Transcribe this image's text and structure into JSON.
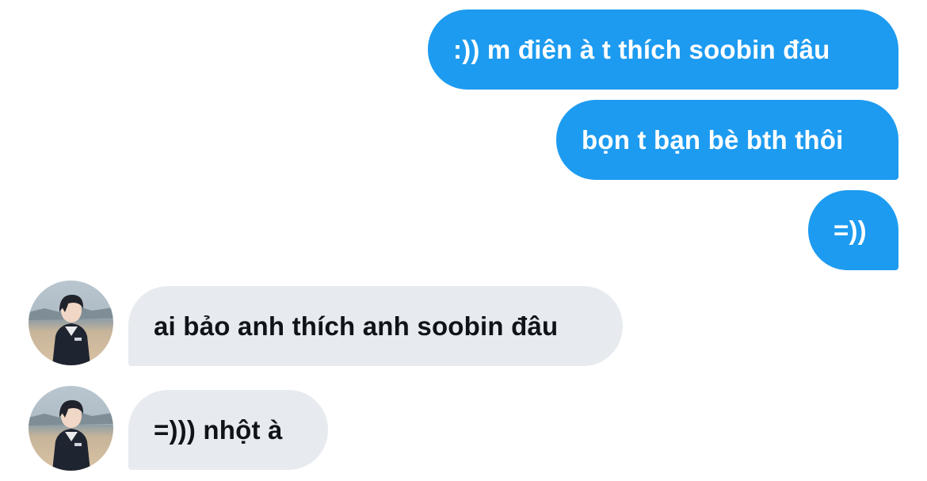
{
  "conversation": {
    "messages": [
      {
        "direction": "outgoing",
        "text": ":)) m điên à t thích soobin đâu"
      },
      {
        "direction": "outgoing",
        "text": "bọn t bạn bè bth thôi"
      },
      {
        "direction": "outgoing",
        "text": "=))"
      },
      {
        "direction": "incoming",
        "text": "ai bảo anh thích anh soobin đâu",
        "avatar": "user-photo-avatar"
      },
      {
        "direction": "incoming",
        "text": "=))) nhột à",
        "avatar": "user-photo-avatar"
      }
    ]
  },
  "colors": {
    "outgoing_bubble": "#1d9bf0",
    "outgoing_text": "#ffffff",
    "incoming_bubble": "#e7ebef",
    "incoming_text": "#0f1419"
  }
}
